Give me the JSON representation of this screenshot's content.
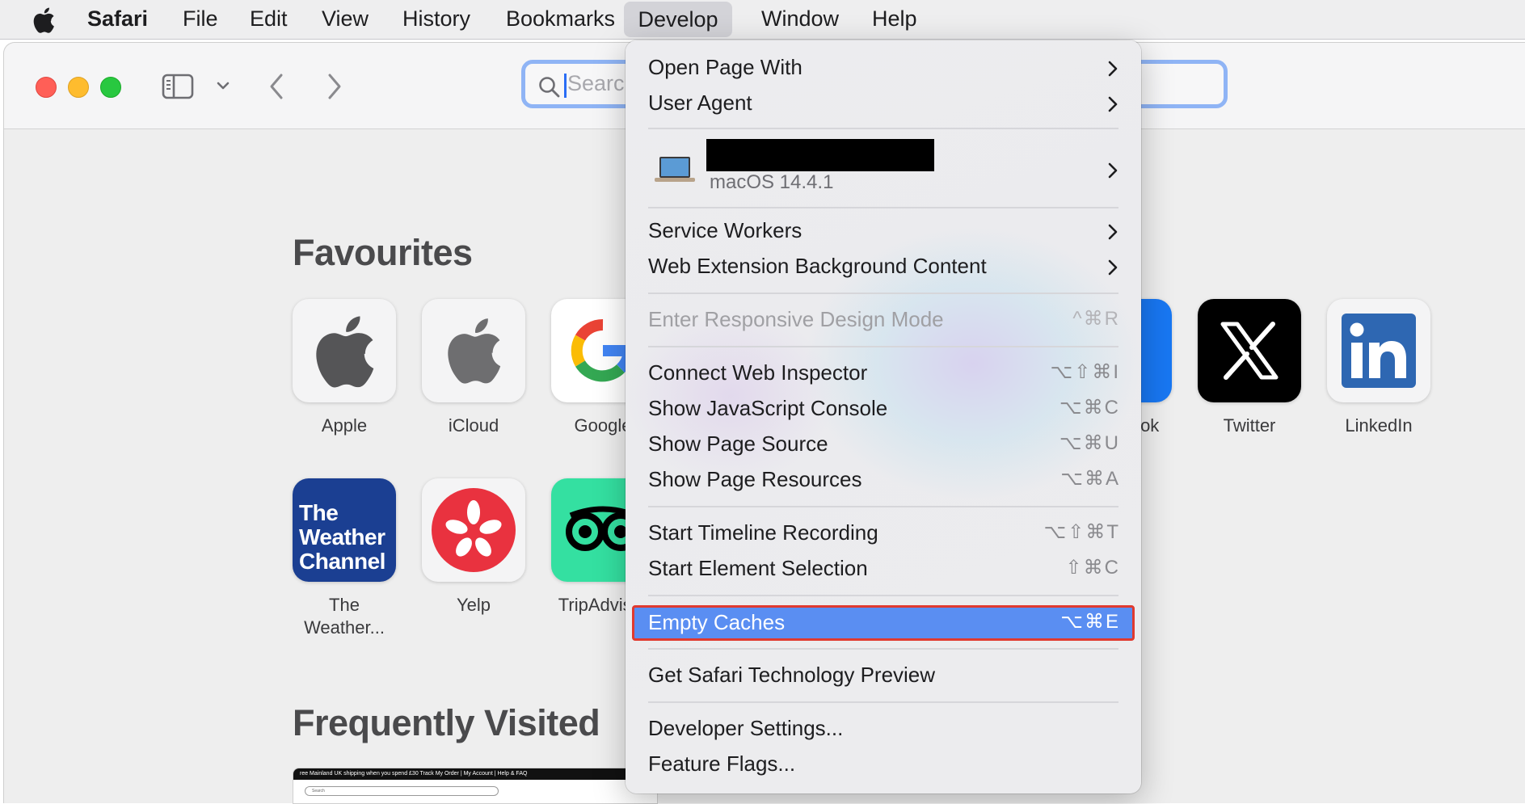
{
  "menubar": {
    "app_name": "Safari",
    "items": [
      "File",
      "Edit",
      "View",
      "History",
      "Bookmarks",
      "Develop",
      "Window",
      "Help"
    ],
    "open_menu": "Develop"
  },
  "toolbar": {
    "search_placeholder": "Search"
  },
  "content": {
    "favourites_title": "Favourites",
    "frequently_visited_title": "Frequently Visited",
    "favourites": [
      {
        "label": "Apple"
      },
      {
        "label": "iCloud"
      },
      {
        "label": "Google"
      },
      {
        "label": "Facebook"
      },
      {
        "label": "Twitter"
      },
      {
        "label": "LinkedIn"
      },
      {
        "label": "The\nWeather..."
      },
      {
        "label": "Yelp"
      },
      {
        "label": "TripAdvisor"
      }
    ],
    "weather_tile_text": [
      "The",
      "Weather",
      "Channel"
    ],
    "thumb_banner": "ree Mainland UK shipping when you spend £30        Track My Order  |  My Account  |  Help & FAQ",
    "thumb_search": "Search"
  },
  "develop_menu": {
    "items": [
      {
        "label": "Open Page With",
        "submenu": true
      },
      {
        "label": "User Agent",
        "submenu": true
      },
      {
        "label": "Service Workers",
        "submenu": true
      },
      {
        "label": "Web Extension Background Content",
        "submenu": true
      },
      {
        "label": "Enter Responsive Design Mode",
        "shortcut": "^⌘R",
        "disabled": true
      },
      {
        "label": "Connect Web Inspector",
        "shortcut": "⌥⇧⌘I"
      },
      {
        "label": "Show JavaScript Console",
        "shortcut": "⌥⌘C"
      },
      {
        "label": "Show Page Source",
        "shortcut": "⌥⌘U"
      },
      {
        "label": "Show Page Resources",
        "shortcut": "⌥⌘A"
      },
      {
        "label": "Start Timeline Recording",
        "shortcut": "⌥⇧⌘T"
      },
      {
        "label": "Start Element Selection",
        "shortcut": "⇧⌘C"
      },
      {
        "label": "Empty Caches",
        "shortcut": "⌥⌘E",
        "highlighted": true
      },
      {
        "label": "Get Safari Technology Preview"
      },
      {
        "label": "Developer Settings..."
      },
      {
        "label": "Feature Flags..."
      }
    ],
    "device": {
      "os": "macOS 14.4.1"
    }
  },
  "colors": {
    "highlight": "#5a8ef2",
    "highlight_outline": "#e03a2f",
    "search_focus": "#8fb4f5"
  }
}
